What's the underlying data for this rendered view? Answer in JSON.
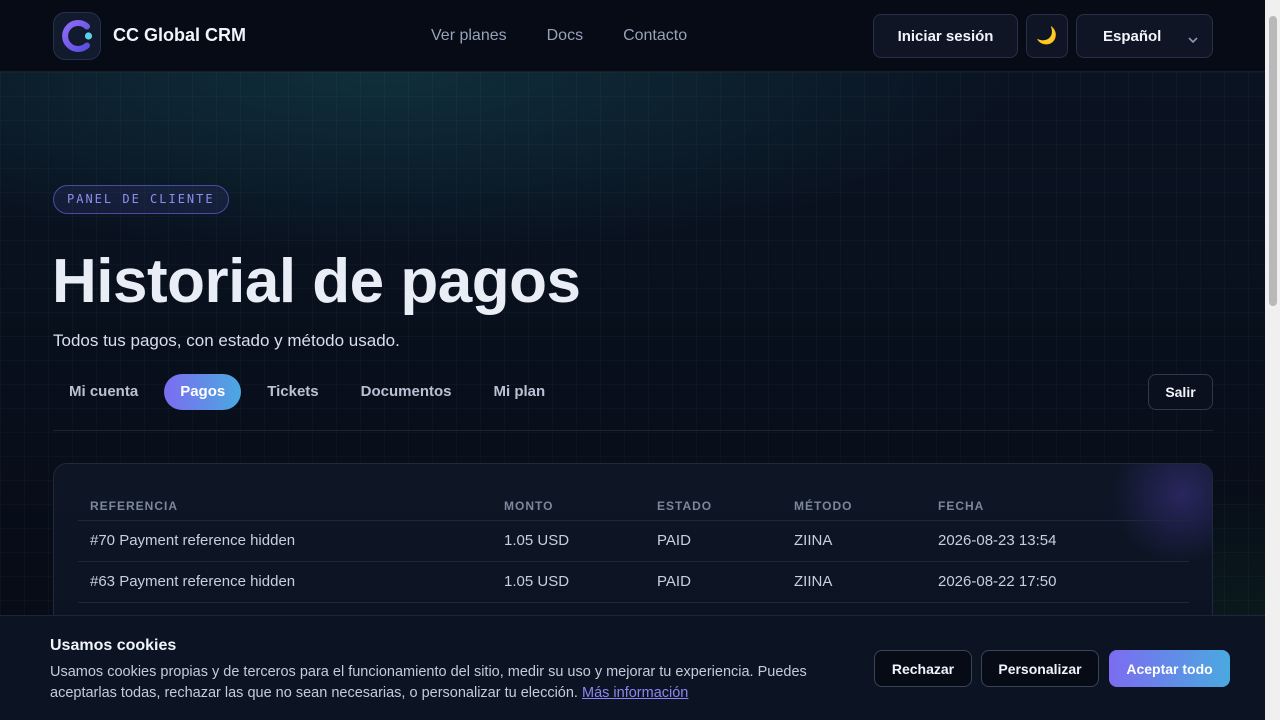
{
  "header": {
    "brand": "CC Global CRM",
    "nav": [
      "Ver planes",
      "Docs",
      "Contacto"
    ],
    "login_label": "Iniciar sesión",
    "theme_icon": "🌙",
    "language": "Español"
  },
  "hero": {
    "badge": "PANEL DE CLIENTE",
    "title": "Historial de pagos",
    "subtitle": "Todos tus pagos, con estado y método usado."
  },
  "tabs": {
    "items": [
      "Mi cuenta",
      "Pagos",
      "Tickets",
      "Documentos",
      "Mi plan"
    ],
    "active": "Pagos",
    "logout_label": "Salir"
  },
  "payments": {
    "columns": [
      "REFERENCIA",
      "MONTO",
      "ESTADO",
      "MÉTODO",
      "FECHA"
    ],
    "rows": [
      [
        "#70 Payment reference hidden",
        "1.05 USD",
        "PAID",
        "ZIINA",
        "2026-08-23 13:54"
      ],
      [
        "#63 Payment reference hidden",
        "1.05 USD",
        "PAID",
        "ZIINA",
        "2026-08-22 17:50"
      ]
    ]
  },
  "cookies": {
    "title": "Usamos cookies",
    "text": "Usamos cookies propias y de terceros para el funcionamiento del sitio, medir su uso y mejorar tu experiencia. Puedes aceptarlas todas, rechazar las que no sean necesarias, o personalizar tu elección.",
    "link": "Más información",
    "reject_label": "Rechazar",
    "customize_label": "Personalizar",
    "accept_label": "Aceptar todo"
  },
  "colors": {
    "accent_start": "#7c6cf0",
    "accent_end": "#4aa9e0",
    "background": "#070b16"
  }
}
